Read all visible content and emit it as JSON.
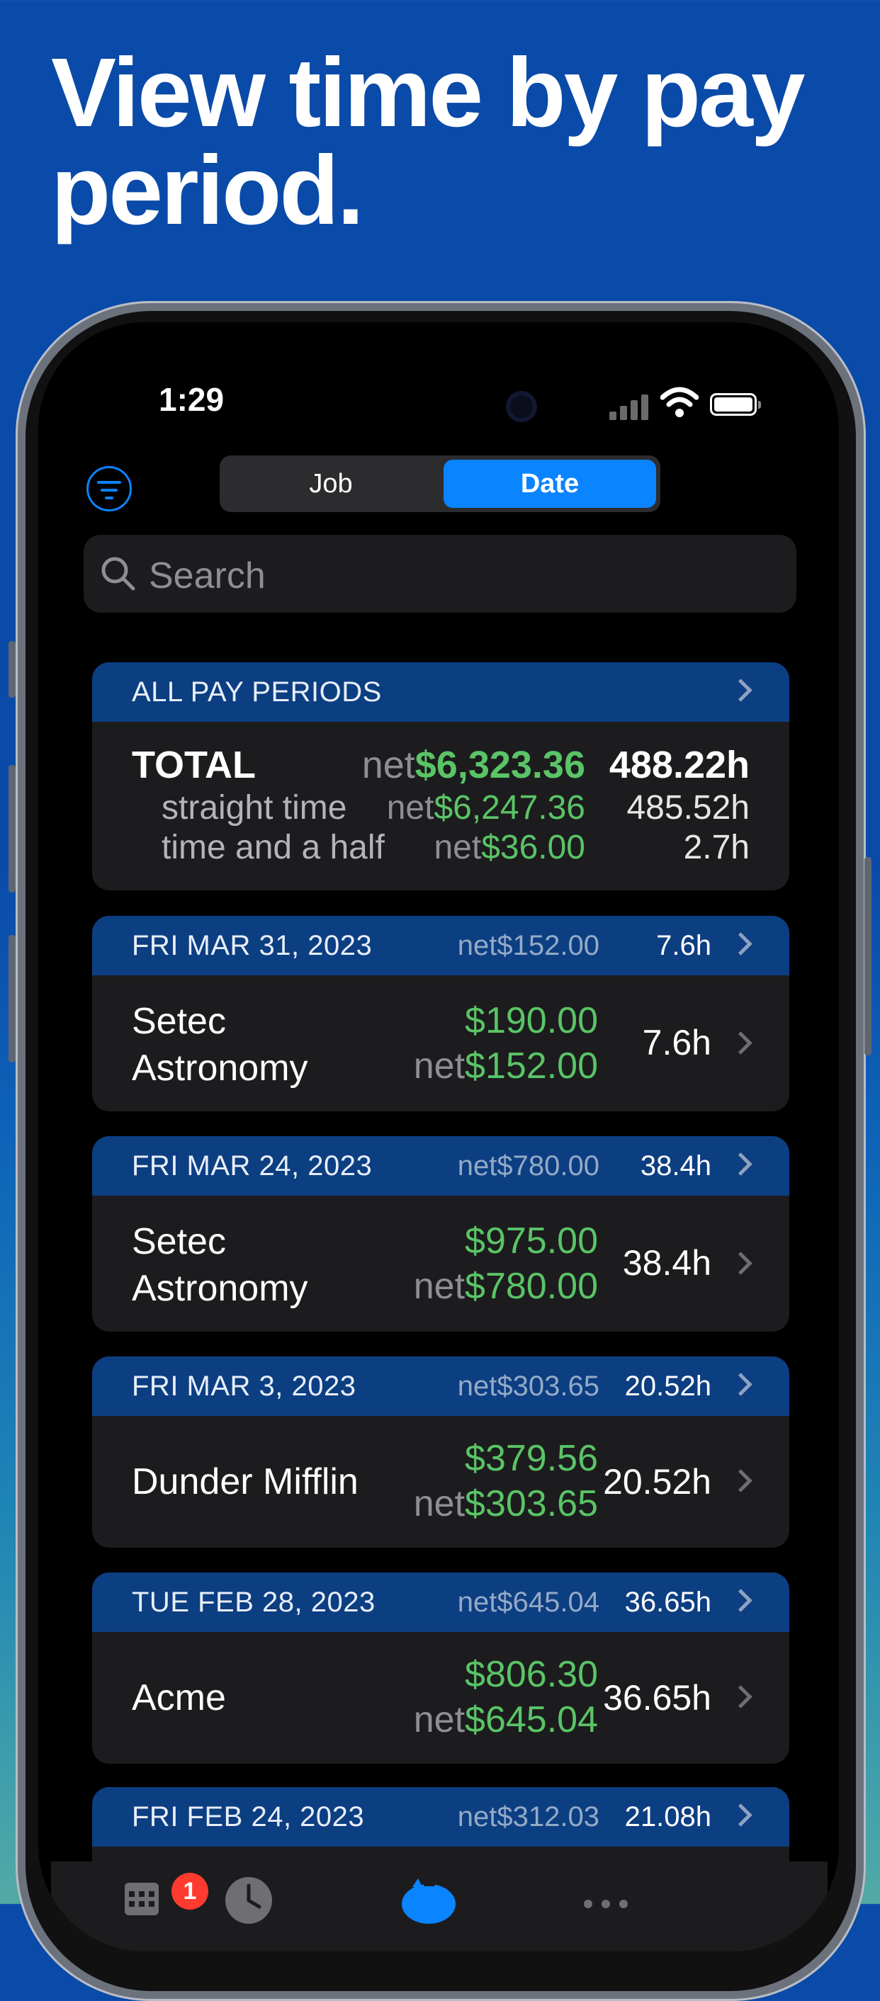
{
  "headline": "View time by pay period.",
  "status_bar": {
    "time": "1:29"
  },
  "segmented": {
    "job_label": "Job",
    "date_label": "Date",
    "selected": "Date"
  },
  "search": {
    "placeholder": "Search"
  },
  "summary": {
    "header": "ALL PAY PERIODS",
    "total": {
      "label": "TOTAL",
      "net_prefix": "net",
      "net_value": "$6,323.36",
      "hours": "488.22h"
    },
    "rows": [
      {
        "label": "straight time",
        "net_prefix": "net",
        "net_value": "$6,247.36",
        "hours": "485.52h"
      },
      {
        "label": "time and a half",
        "net_prefix": "net",
        "net_value": "$36.00",
        "hours": "2.7h"
      }
    ]
  },
  "periods": [
    {
      "date": "FRI MAR 31, 2023",
      "net": "net$152.00",
      "hours": "7.6h",
      "job": {
        "name_line1": "Setec",
        "name_line2": "Astronomy",
        "gross": "$190.00",
        "net_prefix": "net",
        "net_value": "$152.00",
        "hours": "7.6h"
      }
    },
    {
      "date": "FRI MAR 24, 2023",
      "net": "net$780.00",
      "hours": "38.4h",
      "job": {
        "name_line1": "Setec",
        "name_line2": "Astronomy",
        "gross": "$975.00",
        "net_prefix": "net",
        "net_value": "$780.00",
        "hours": "38.4h"
      }
    },
    {
      "date": "FRI MAR 3, 2023",
      "net": "net$303.65",
      "hours": "20.52h",
      "job": {
        "name_line1": "Dunder Mifflin",
        "name_line2": "",
        "gross": "$379.56",
        "net_prefix": "net",
        "net_value": "$303.65",
        "hours": "20.52h"
      }
    },
    {
      "date": "TUE FEB 28, 2023",
      "net": "net$645.04",
      "hours": "36.65h",
      "job": {
        "name_line1": "Acme",
        "name_line2": "",
        "gross": "$806.30",
        "net_prefix": "net",
        "net_value": "$645.04",
        "hours": "36.65h"
      }
    },
    {
      "date": "FRI FEB 24, 2023",
      "net": "net$312.03",
      "hours": "21.08h"
    }
  ],
  "tabbar": {
    "badge_count": "1",
    "tabs": [
      "calendar-icon",
      "clock-icon",
      "piggy-bank-icon",
      "more-icon"
    ]
  },
  "colors": {
    "accent": "#0a84ff",
    "money_green": "#5ac466",
    "section_header": "#0c3e82",
    "background_blue": "#0a4aa8"
  }
}
